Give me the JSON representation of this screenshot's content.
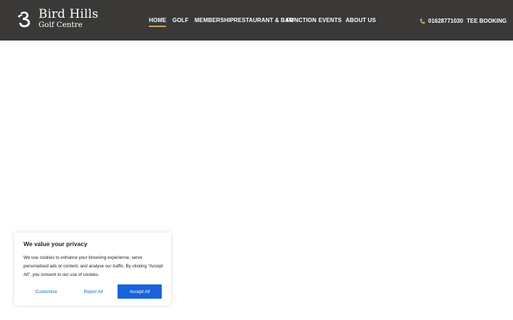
{
  "logo": {
    "title": "Bird Hills",
    "subtitle": "Golf Centre"
  },
  "nav": {
    "items": [
      {
        "label": "HOME",
        "active": true
      },
      {
        "label": "GOLF"
      },
      {
        "label": "MEMBERSHIP"
      },
      {
        "label": "RESTAURANT & BAR"
      },
      {
        "label": "FUNCTION"
      },
      {
        "label": "EVENTS"
      },
      {
        "label": "ABOUT US"
      }
    ]
  },
  "header": {
    "phone": "01628771030",
    "tee_booking": "TEE BOOKING"
  },
  "cookie": {
    "title": "We value your privacy",
    "text": "We use cookies to enhance your browsing experience, serve personalised ads or content, and analyse our traffic. By clicking \"Accept All\", you consent to our use of cookies.",
    "customise": "Customise",
    "reject": "Reject All",
    "accept": "Accept All"
  },
  "colors": {
    "header_bg": "#3a3937",
    "accent_gold": "#c9a45c",
    "button_blue": "#1863dc"
  },
  "icons": {
    "phone": "phone-icon",
    "logo": "bird-hills-logo-mark"
  }
}
